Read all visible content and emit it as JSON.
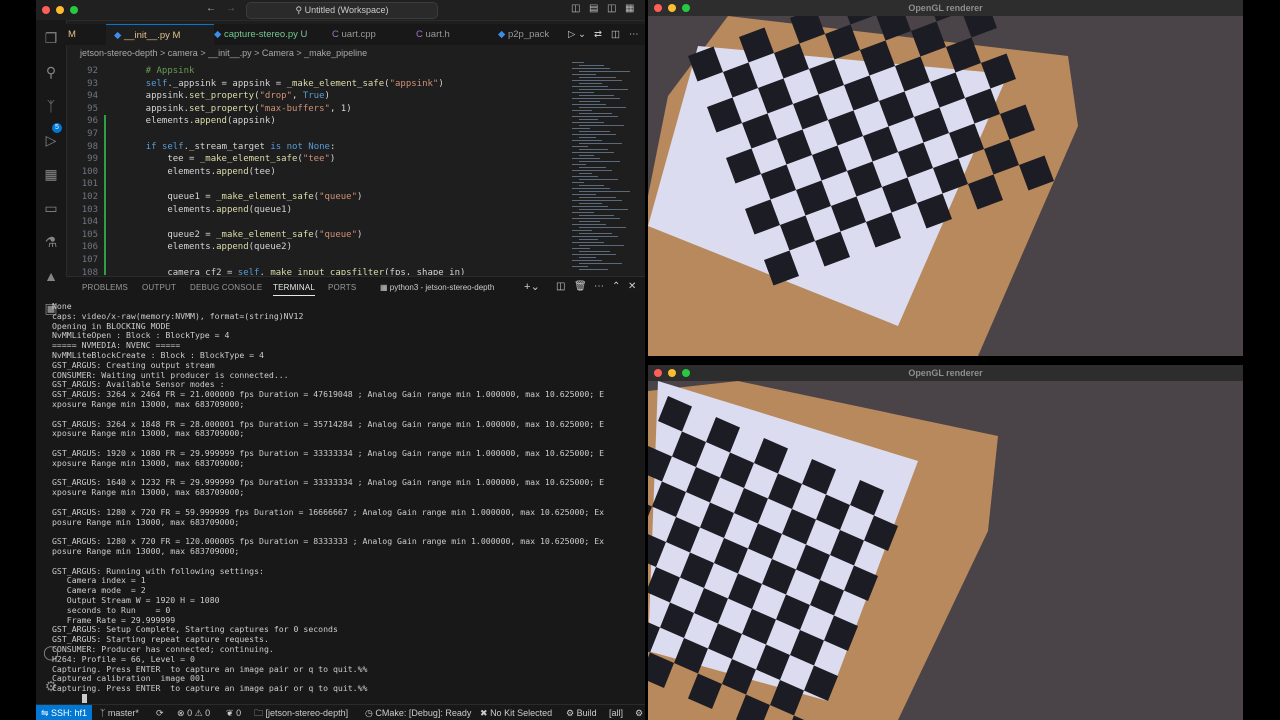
{
  "vscode": {
    "window_title": "Untitled (Workspace)",
    "tabs": [
      {
        "label": "M"
      },
      {
        "label": "__init__.py M"
      },
      {
        "label": "capture-stereo.py U"
      },
      {
        "label": "uart.cpp"
      },
      {
        "label": "uart.h"
      },
      {
        "label": "p2p_pack"
      }
    ],
    "breadcrumb": "jetson-stereo-depth  >  camera  >  __init__.py  >  Camera  >  _make_pipeline",
    "code_lines": [
      {
        "n": "92",
        "text": "    # Appsink"
      },
      {
        "n": "93",
        "text": "    self._appsink = appsink = _make_element_safe(\"appsink\")"
      },
      {
        "n": "94",
        "text": "    appsink.set_property(\"drop\", True)"
      },
      {
        "n": "95",
        "text": "    appsink.set_property(\"max-buffers\", 1)"
      },
      {
        "n": "96",
        "text": "    elements.append(appsink)"
      },
      {
        "n": "97",
        "text": ""
      },
      {
        "n": "98",
        "text": "    if self._stream_target is not None:"
      },
      {
        "n": "99",
        "text": "        tee = _make_element_safe(\"tee\")"
      },
      {
        "n": "100",
        "text": "        elements.append(tee)"
      },
      {
        "n": "101",
        "text": ""
      },
      {
        "n": "102",
        "text": "        queue1 = _make_element_safe(\"queue\")"
      },
      {
        "n": "103",
        "text": "        elements.append(queue1)"
      },
      {
        "n": "104",
        "text": ""
      },
      {
        "n": "105",
        "text": "        queue2 = _make_element_safe(\"queue\")"
      },
      {
        "n": "106",
        "text": "        elements.append(queue2)"
      },
      {
        "n": "107",
        "text": ""
      },
      {
        "n": "108",
        "text": "        camera_cf2 = self._make_input_capsfilter(fps, shape_in)"
      }
    ],
    "panel_tabs": [
      "PROBLEMS",
      "OUTPUT",
      "DEBUG CONSOLE",
      "TERMINAL",
      "PORTS"
    ],
    "terminal_selector": "python3 - jetson-stereo-depth",
    "terminal_lines": [
      "None",
      "caps: video/x-raw(memory:NVMM), format=(string)NV12",
      "Opening in BLOCKING MODE",
      "NvMMLiteOpen : Block : BlockType = 4",
      "===== NVMEDIA: NVENC =====",
      "NvMMLiteBlockCreate : Block : BlockType = 4",
      "GST_ARGUS: Creating output stream",
      "CONSUMER: Waiting until producer is connected...",
      "GST_ARGUS: Available Sensor modes :",
      "GST_ARGUS: 3264 x 2464 FR = 21.000000 fps Duration = 47619048 ; Analog Gain range min 1.000000, max 10.625000; E",
      "xposure Range min 13000, max 683709000;",
      "",
      "GST_ARGUS: 3264 x 1848 FR = 28.000001 fps Duration = 35714284 ; Analog Gain range min 1.000000, max 10.625000; E",
      "xposure Range min 13000, max 683709000;",
      "",
      "GST_ARGUS: 1920 x 1080 FR = 29.999999 fps Duration = 33333334 ; Analog Gain range min 1.000000, max 10.625000; E",
      "xposure Range min 13000, max 683709000;",
      "",
      "GST_ARGUS: 1640 x 1232 FR = 29.999999 fps Duration = 33333334 ; Analog Gain range min 1.000000, max 10.625000; E",
      "xposure Range min 13000, max 683709000;",
      "",
      "GST_ARGUS: 1280 x 720 FR = 59.999999 fps Duration = 16666667 ; Analog Gain range min 1.000000, max 10.625000; Ex",
      "posure Range min 13000, max 683709000;",
      "",
      "GST_ARGUS: 1280 x 720 FR = 120.000005 fps Duration = 8333333 ; Analog Gain range min 1.000000, max 10.625000; Ex",
      "posure Range min 13000, max 683709000;",
      "",
      "GST_ARGUS: Running with following settings:",
      "   Camera index = 1",
      "   Camera mode  = 2",
      "   Output Stream W = 1920 H = 1080",
      "   seconds to Run    = 0",
      "   Frame Rate = 29.999999",
      "GST_ARGUS: Setup Complete, Starting captures for 0 seconds",
      "GST_ARGUS: Starting repeat capture requests.",
      "CONSUMER: Producer has connected; continuing.",
      "H264: Profile = 66, Level = 0",
      "Capturing. Press ENTER  to capture an image pair or q to quit.%%",
      "Captured calibration  image 001",
      "Capturing. Press ENTER  to capture an image pair or q to quit.%%"
    ],
    "status": {
      "remote": "SSH: hf1",
      "branch": "master*",
      "problems": "0 ⚠ 0",
      "ports": "0",
      "folder": "[jetson-stereo-depth]",
      "cmake": "CMake: [Debug]: Ready",
      "kit": "No Kit Selected",
      "build": "Build",
      "target": "[all]"
    }
  },
  "renderer_windows": [
    {
      "title": "OpenGL renderer"
    },
    {
      "title": "OpenGL renderer"
    }
  ],
  "colors": {
    "accent": "#0078d4",
    "close": "#ff5f57",
    "minimize": "#febc2e",
    "maximize": "#28c840"
  }
}
